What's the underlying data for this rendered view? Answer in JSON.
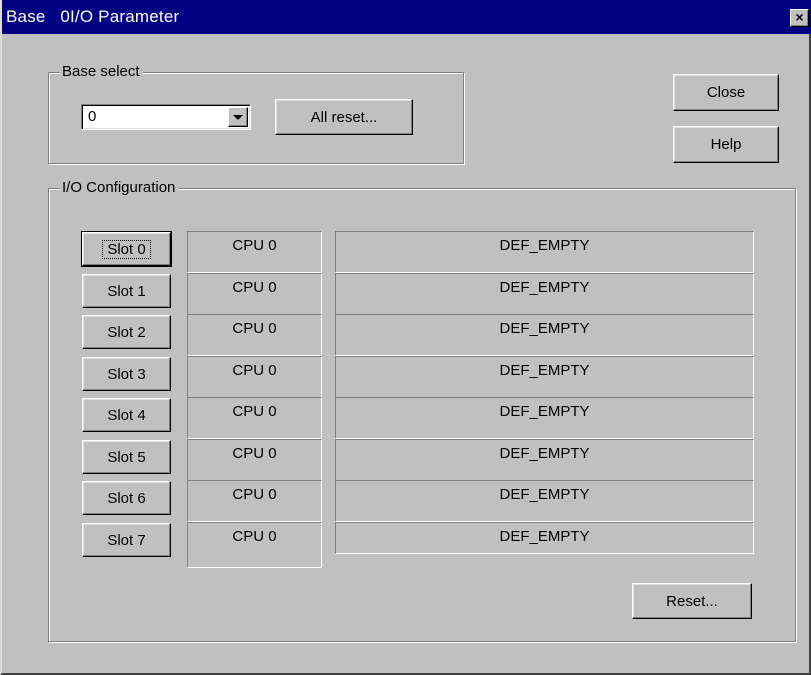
{
  "window": {
    "title": "Base   0I/O Parameter",
    "close_glyph": "×"
  },
  "base_select": {
    "legend": "Base select",
    "combo_value": "0",
    "all_reset_label": "All reset..."
  },
  "side_buttons": {
    "close_label": "Close",
    "help_label": "Help"
  },
  "io_config": {
    "legend": "I/O Configuration",
    "reset_label": "Reset...",
    "slots": [
      {
        "label": "Slot 0",
        "cpu": "CPU 0",
        "module": "DEF_EMPTY"
      },
      {
        "label": "Slot 1",
        "cpu": "CPU 0",
        "module": "DEF_EMPTY"
      },
      {
        "label": "Slot 2",
        "cpu": "CPU 0",
        "module": "DEF_EMPTY"
      },
      {
        "label": "Slot 3",
        "cpu": "CPU 0",
        "module": "DEF_EMPTY"
      },
      {
        "label": "Slot 4",
        "cpu": "CPU 0",
        "module": "DEF_EMPTY"
      },
      {
        "label": "Slot 5",
        "cpu": "CPU 0",
        "module": "DEF_EMPTY"
      },
      {
        "label": "Slot 6",
        "cpu": "CPU 0",
        "module": "DEF_EMPTY"
      },
      {
        "label": "Slot 7",
        "cpu": "CPU 0",
        "module": "DEF_EMPTY"
      }
    ]
  }
}
